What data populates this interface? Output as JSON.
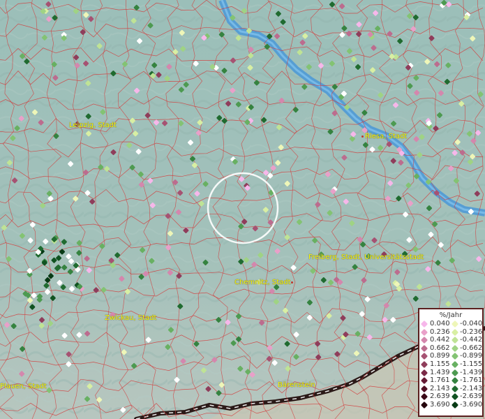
{
  "cities": [
    {
      "name": "Leipzig, Stadt"
    },
    {
      "name": "Riesa, Stadt"
    },
    {
      "name": "Freiberg, Stadt, Universitätsstadt"
    },
    {
      "name": "Chemnitz, Stadt"
    },
    {
      "name": "Zwickau, Stadt"
    },
    {
      "name": "Plauen, Stadt"
    },
    {
      "name": "Bärenstein"
    }
  ],
  "legend": {
    "title": "%/Jahr",
    "positive": [
      "0.040",
      "0.236",
      "0.442",
      "0.662",
      "0.899",
      "1.155",
      "1.439",
      "1.761",
      "2.143",
      "2.639",
      "3.690"
    ],
    "negative": [
      "-0.040",
      "-0.236",
      "-0.442",
      "-0.662",
      "-0.899",
      "-1.155",
      "-1.439",
      "-1.761",
      "-2.143",
      "-2.639",
      "-3.690"
    ],
    "positive_colors": [
      "#f6b7ea",
      "#e9a0c9",
      "#d487ad",
      "#bc6c8e",
      "#a65272",
      "#8f3d5b",
      "#7a2a47",
      "#661b35",
      "#521024",
      "#3a0816",
      "#24040c"
    ],
    "negative_colors": [
      "#eef6b8",
      "#d8efa3",
      "#bfe395",
      "#9fd384",
      "#83c373",
      "#68b062",
      "#4d9a51",
      "#358340",
      "#206b30",
      "#105321",
      "#073a15"
    ]
  },
  "colors": {
    "terrain": "#9cbcb4",
    "river": "#5aa3dc",
    "border_red": "#d43a3a",
    "country_border": "#2b1a18",
    "label_yellow": "#ffff00",
    "selection_ring": "#ffffff"
  }
}
